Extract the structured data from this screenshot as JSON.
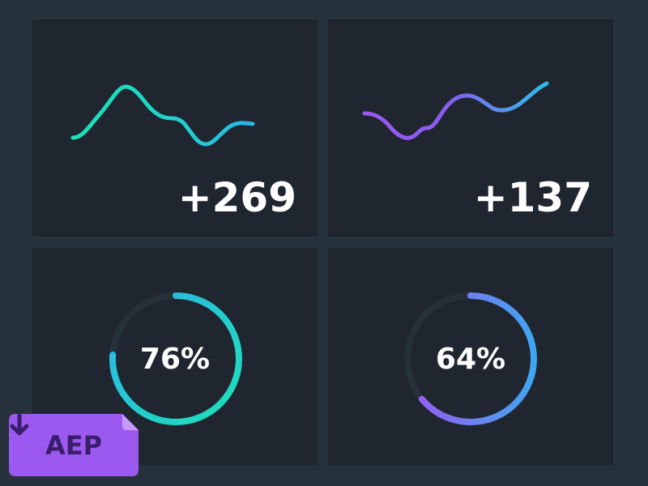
{
  "colors": {
    "background": "#25313b",
    "panel": "#1f262f",
    "teal": "#1ee0b8",
    "cyan": "#28b4e8",
    "purple": "#9b59f0",
    "blue": "#3fa6f0",
    "badge": "#9b59f0",
    "badge_text": "#3a1e6e"
  },
  "stats": [
    {
      "value_label": "+269",
      "sparkline_icon": "sparkline-teal"
    },
    {
      "value_label": "+137",
      "sparkline_icon": "sparkline-purple"
    }
  ],
  "rings": [
    {
      "label": "76%",
      "percent": 76
    },
    {
      "label": "64%",
      "percent": 64
    }
  ],
  "badge": {
    "label": "AEP",
    "icon": "download-arrow-icon"
  }
}
